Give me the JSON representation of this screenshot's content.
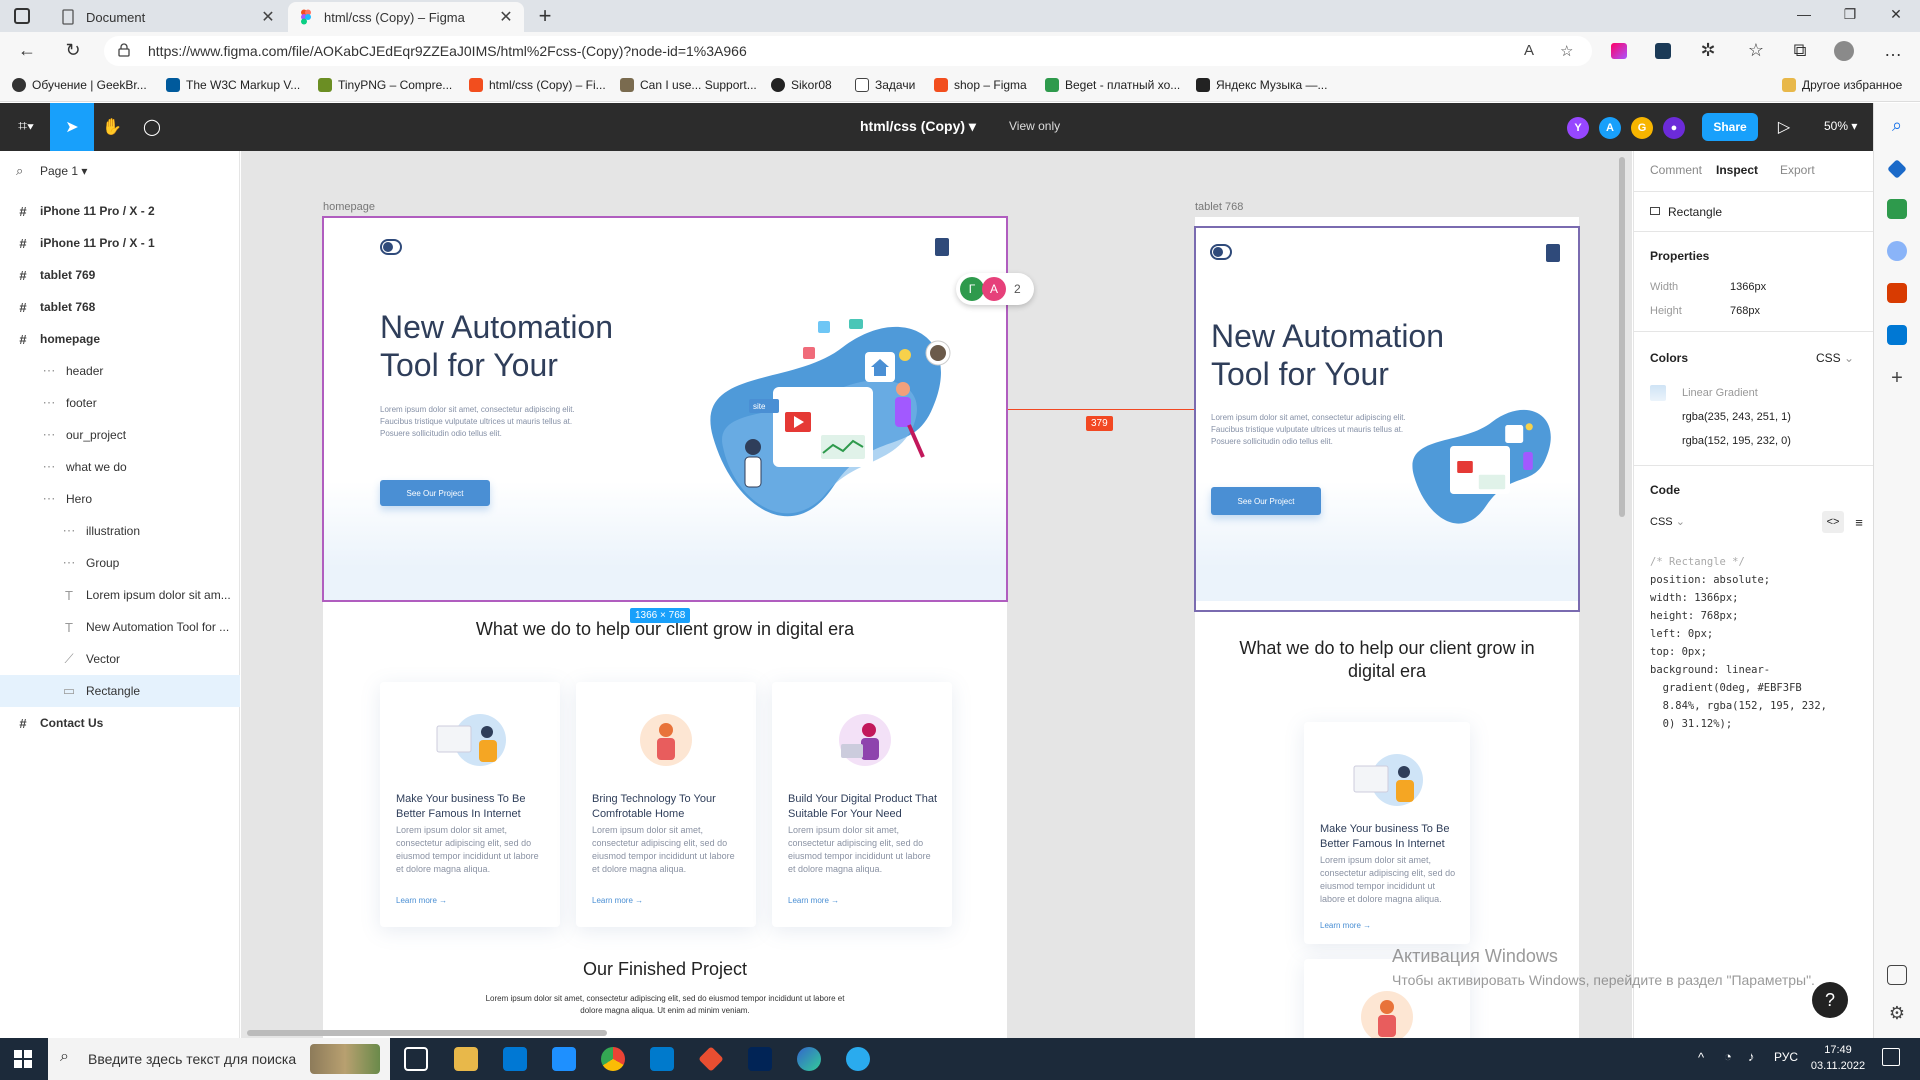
{
  "browser": {
    "tabs": [
      {
        "label": "Document"
      },
      {
        "label": "html/css (Copy) – Figma"
      }
    ],
    "url": "https://www.figma.com/file/AOKabCJEdEqr9ZZEaJ0IMS/html%2Fcss-(Copy)?node-id=1%3A966",
    "bookmarks": [
      "Обучение | GeekBr...",
      "The W3C Markup V...",
      "TinyPNG – Compre...",
      "html/css (Copy) – Fi...",
      "Can I use... Support...",
      "Sikor08",
      "Задачи",
      "shop – Figma",
      "Beget - платный хо...",
      "Яндекс Музыка —...",
      "Другое избранное"
    ]
  },
  "toolbar": {
    "file_title": "html/css (Copy)",
    "view_only": "View only",
    "avatars": [
      "Y",
      "A",
      "G"
    ],
    "share": "Share",
    "zoom": "50%"
  },
  "layers": {
    "page": "Page 1",
    "items": [
      {
        "name": "iPhone 11 Pro / X - 2",
        "icon": "#"
      },
      {
        "name": "iPhone 11 Pro / X - 1",
        "icon": "#"
      },
      {
        "name": "tablet 769",
        "icon": "#"
      },
      {
        "name": "tablet 768",
        "icon": "#"
      },
      {
        "name": "homepage",
        "icon": "#"
      },
      {
        "name": "header",
        "icon": "group"
      },
      {
        "name": "footer",
        "icon": "group"
      },
      {
        "name": "our_project",
        "icon": "group"
      },
      {
        "name": "what we do",
        "icon": "group"
      },
      {
        "name": "Hero",
        "icon": "group"
      },
      {
        "name": "illustration",
        "icon": "group"
      },
      {
        "name": "Group",
        "icon": "group"
      },
      {
        "name": "Lorem ipsum dolor sit am...",
        "icon": "T"
      },
      {
        "name": "New Automation Tool for ...",
        "icon": "T"
      },
      {
        "name": "Vector",
        "icon": "vector"
      },
      {
        "name": "Rectangle",
        "icon": "rect"
      },
      {
        "name": "Contact Us",
        "icon": "#"
      }
    ]
  },
  "canvas": {
    "homepage_label": "homepage",
    "tablet_label": "tablet 768",
    "size_badge": "1366 × 768",
    "distance_badge": "379",
    "comment_avatars": [
      "Г",
      "А"
    ],
    "comment_count": "2",
    "hero_title": "New Automation Tool for Your",
    "hero_text": "Lorem ipsum dolor sit amet, consectetur adipiscing elit. Faucibus tristique vulputate ultrices ut mauris tellus at. Posuere sollicitudin odio tellus elit.",
    "hero_button": "See Our Project",
    "hero_art_label": "site",
    "section_title": "What we do to help our client grow in digital era",
    "cards": [
      {
        "title": "Make Your business To Be Better Famous In Internet",
        "text": "Lorem ipsum dolor sit amet, consectetur adipiscing elit, sed do eiusmod tempor incididunt ut labore et dolore magna aliqua.",
        "link": "Learn more"
      },
      {
        "title": "Bring Technology To Your Comfrotable Home",
        "text": "Lorem ipsum dolor sit amet, consectetur adipiscing elit, sed do eiusmod tempor incididunt ut labore et dolore magna aliqua.",
        "link": "Learn more"
      },
      {
        "title": "Build Your Digital Product That Suitable For Your Need",
        "text": "Lorem ipsum dolor sit amet, consectetur adipiscing elit, sed do eiusmod tempor incididunt ut labore et dolore magna aliqua.",
        "link": "Learn more"
      }
    ],
    "project_title": "Our Finished Project",
    "project_text": "Lorem ipsum dolor sit amet, consectetur adipiscing elit, sed do eiusmod tempor incididunt ut labore et dolore magna aliqua. Ut enim ad minim veniam."
  },
  "inspect": {
    "tabs": [
      "Comment",
      "Inspect",
      "Export"
    ],
    "layer_name": "Rectangle",
    "properties_title": "Properties",
    "width_label": "Width",
    "width_value": "1366px",
    "height_label": "Height",
    "height_value": "768px",
    "colors_title": "Colors",
    "colors_format": "CSS",
    "gradient_label": "Linear Gradient",
    "color_stops": [
      "rgba(235, 243, 251, 1)",
      "rgba(152, 195, 232, 0)"
    ],
    "code_title": "Code",
    "code_lang": "CSS",
    "code_lines": [
      "/* Rectangle */",
      "",
      "position: absolute;",
      "width: 1366px;",
      "height: 768px;",
      "left: 0px;",
      "top: 0px;",
      "",
      "background: linear-",
      "  gradient(0deg, #EBF3FB",
      "  8.84%, rgba(152, 195, 232,",
      "  0) 31.12%);"
    ]
  },
  "watermark": {
    "line1": "Активация Windows",
    "line2": "Чтобы активировать Windows, перейдите в раздел \"Параметры\"."
  },
  "taskbar": {
    "search_placeholder": "Введите здесь текст для поиска",
    "lang": "РУС",
    "time": "17:49",
    "date": "03.11.2022"
  },
  "colors": {
    "figma_blue": "#18a0fb",
    "hero_button": "#4a8fd4",
    "selection": "#e5f2fd",
    "distance_red": "#f24822"
  }
}
